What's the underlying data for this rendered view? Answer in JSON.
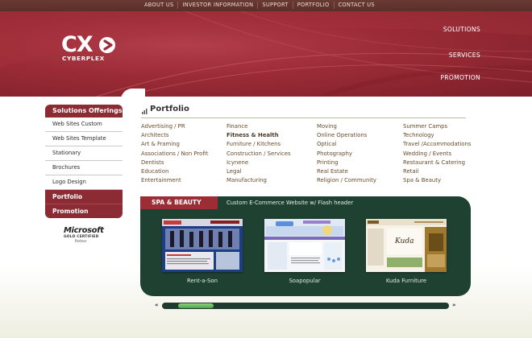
{
  "top_nav": [
    "ABOUT US",
    "INVESTOR INFORMATION",
    "SUPPORT",
    "PORTFOLIO",
    "CONTACT US"
  ],
  "logo": {
    "mark": "CX",
    "word": "CYBERPLEX"
  },
  "header_nav": [
    "SOLUTIONS",
    "SERVICES",
    "PROMOTION"
  ],
  "sidebar": {
    "heading": "Solutions Offerings",
    "items": [
      "Web Sites Custom",
      "Web Sites Template",
      "Stationary",
      "Brochures",
      "Logo Design"
    ],
    "red_items": [
      "Portfolio",
      "Promotion"
    ]
  },
  "ms_badge": {
    "word": "Microsoft",
    "line": "GOLD CERTIFIED",
    "partner": "Partner"
  },
  "portfolio": {
    "title": "Portfolio",
    "columns": [
      [
        "Advertising / PR",
        "Architects",
        "Art & Framing",
        "Associations / Non Profit",
        "Dentists",
        "Education",
        "Entertainment"
      ],
      [
        "Finance",
        "Fitness & Health",
        "Furniture / Kitchens",
        "Construction / Services",
        "Icynene",
        "Legal",
        "Manufacturing"
      ],
      [
        "Moving",
        "Online Operations",
        "Optical",
        "Photography",
        "Printing",
        "Real Estate",
        "Religion / Community"
      ],
      [
        "Summer Camps",
        "Technology",
        "Travel /Accommodations",
        "Wedding / Events",
        "Restaurant & Catering",
        "Retail",
        "Spa & Beauty"
      ]
    ],
    "bold_item": "Fitness & Health"
  },
  "showcase": {
    "tab": "SPA & BEAUTY",
    "description": "Custom E-Commerce Website w/ Flash header",
    "thumbs": [
      "Rent-a-Son",
      "Soapopular",
      "Kuda Furniture"
    ]
  },
  "scroll": {
    "left": "«",
    "right": "»",
    "position_fraction": 0.06
  },
  "colors": {
    "brand_red": "#8c2b33",
    "panel_green": "#1f4132",
    "accent_green": "#6cbf63"
  }
}
